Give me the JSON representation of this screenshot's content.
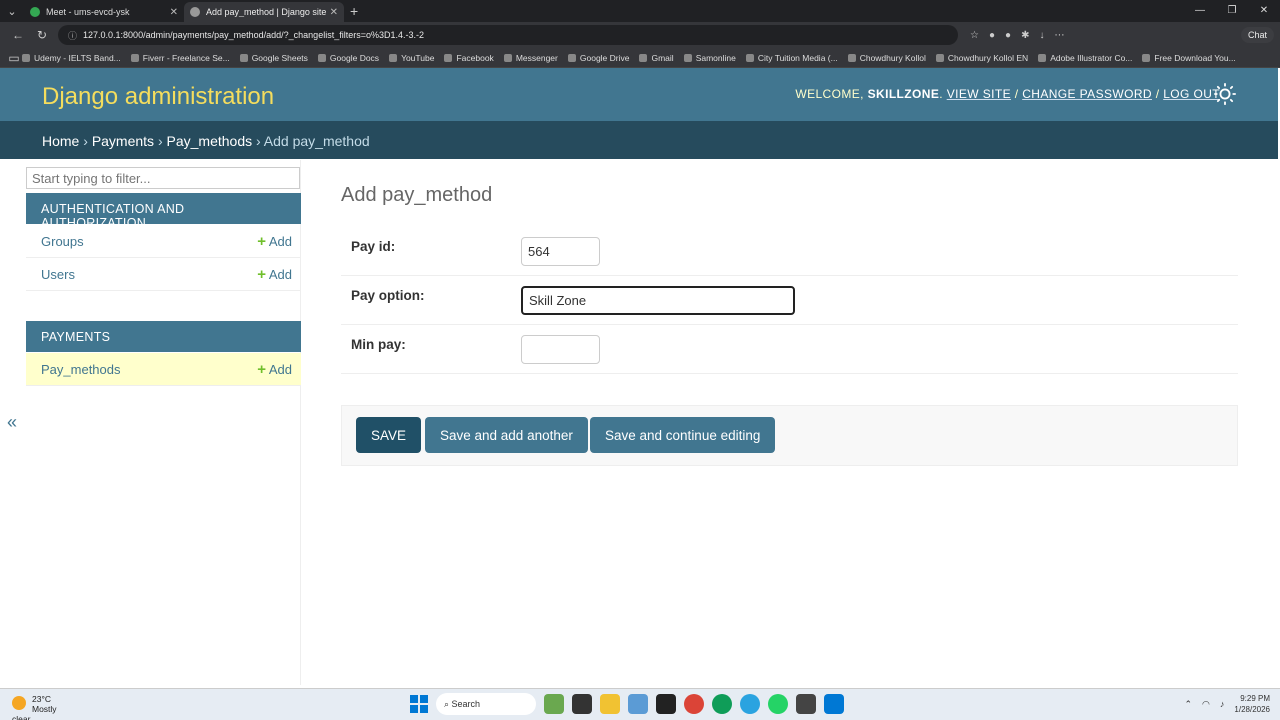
{
  "browser": {
    "tabs": [
      {
        "title": "Meet - ums-evcd-ysk",
        "active": false,
        "fav_color": "#34a853"
      },
      {
        "title": "Add pay_method | Django site ad",
        "active": true,
        "fav_color": "#999999"
      }
    ],
    "url": "127.0.0.1:8000/admin/payments/pay_method/add/?_changelist_filters=o%3D1.4.-3.-2",
    "chat_label": "Chat",
    "bookmarks": [
      "Udemy - IELTS Band...",
      "Fiverr - Freelance Se...",
      "Google Sheets",
      "Google Docs",
      "YouTube",
      "Facebook",
      "Messenger",
      "Google Drive",
      "Gmail",
      "Samonline",
      "City Tuition Media (...",
      "Chowdhury Kollol",
      "Chowdhury Kollol EN",
      "Adobe Illustrator Co...",
      "Free Download You..."
    ]
  },
  "header": {
    "brand": "Django administration",
    "welcome": "WELCOME,",
    "username": "SKILLZONE",
    "view_site": "VIEW SITE",
    "change_password": "CHANGE PASSWORD",
    "log_out": "LOG OUT"
  },
  "breadcrumbs": {
    "home": "Home",
    "app": "Payments",
    "model": "Pay_methods",
    "current": "Add pay_method"
  },
  "sidebar": {
    "filter_placeholder": "Start typing to filter...",
    "auth_caption": "AUTHENTICATION AND AUTHORIZATION",
    "groups": "Groups",
    "users": "Users",
    "payments_caption": "PAYMENTS",
    "pay_methods": "Pay_methods",
    "add_label": "Add",
    "collapse": "«"
  },
  "form": {
    "title": "Add pay_method",
    "pay_id_label": "Pay id:",
    "pay_id_value": "564",
    "pay_option_label": "Pay option:",
    "pay_option_value": "Skill Zone",
    "min_pay_label": "Min pay:",
    "min_pay_value": ""
  },
  "buttons": {
    "save": "SAVE",
    "save_add_another": "Save and add another",
    "save_continue": "Save and continue editing"
  },
  "taskbar": {
    "temp": "23°C",
    "weather": "Mostly clear",
    "search": "Search",
    "time": "9:29 PM",
    "date": "1/28/2026"
  }
}
